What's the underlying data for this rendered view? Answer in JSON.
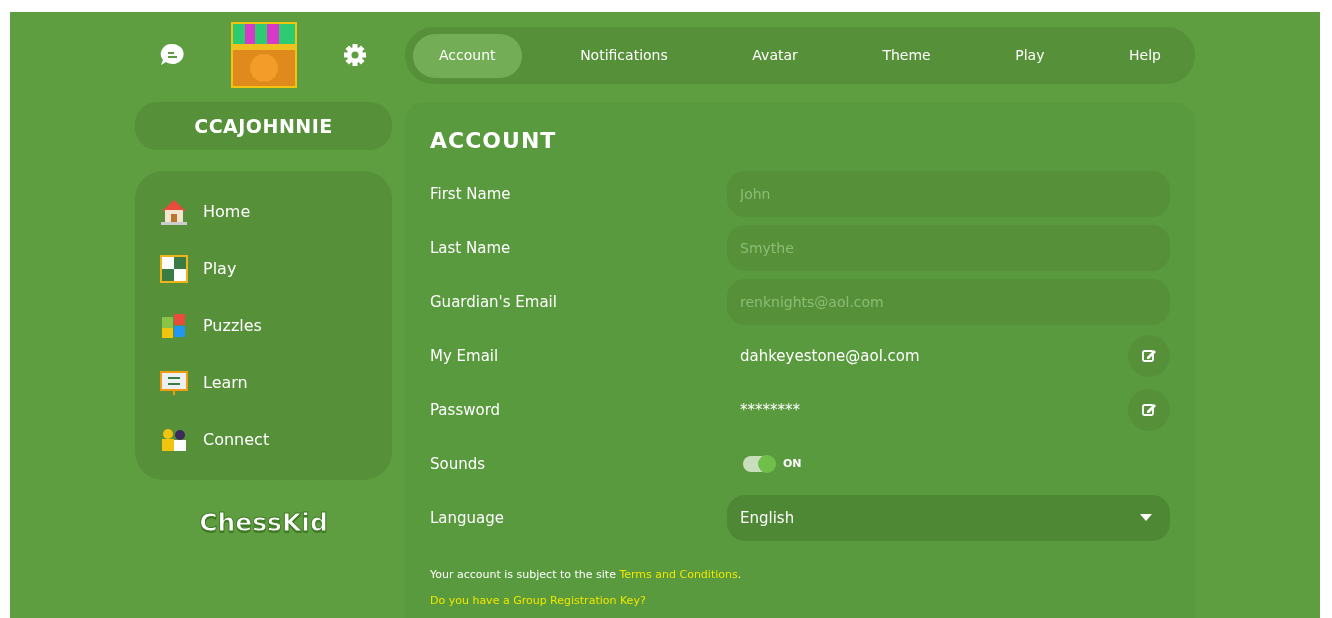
{
  "profile": {
    "username": "CCAJOHNNIE"
  },
  "nav": [
    {
      "label": "Home"
    },
    {
      "label": "Play"
    },
    {
      "label": "Puzzles"
    },
    {
      "label": "Learn"
    },
    {
      "label": "Connect"
    }
  ],
  "logo": {
    "text": "ChessKid"
  },
  "tabs": [
    {
      "label": "Account",
      "selected": true
    },
    {
      "label": "Notifications",
      "selected": false
    },
    {
      "label": "Avatar",
      "selected": false
    },
    {
      "label": "Theme",
      "selected": false
    },
    {
      "label": "Play",
      "selected": false
    },
    {
      "label": "Help",
      "selected": false
    }
  ],
  "section_title": "ACCOUNT",
  "fields": [
    {
      "kind": "text",
      "label": "First Name",
      "value": "John",
      "disabled": true
    },
    {
      "kind": "text",
      "label": "Last Name",
      "value": "Smythe",
      "disabled": true
    },
    {
      "kind": "text",
      "label": "Guardian's Email",
      "value": "renknights@aol.com",
      "disabled": true
    },
    {
      "kind": "editable",
      "label": "My Email",
      "value": "dahkeyestone@aol.com"
    },
    {
      "kind": "editable",
      "label": "Password",
      "value": "********"
    },
    {
      "kind": "toggle",
      "label": "Sounds",
      "on": true,
      "state_text": "ON"
    },
    {
      "kind": "select",
      "label": "Language",
      "value": "English"
    }
  ],
  "footer": {
    "notice": "Your account is subject to the site",
    "terms_link": "Terms and Conditions",
    "period": ".",
    "group_key_link": "Do you have a Group Registration Key?"
  }
}
